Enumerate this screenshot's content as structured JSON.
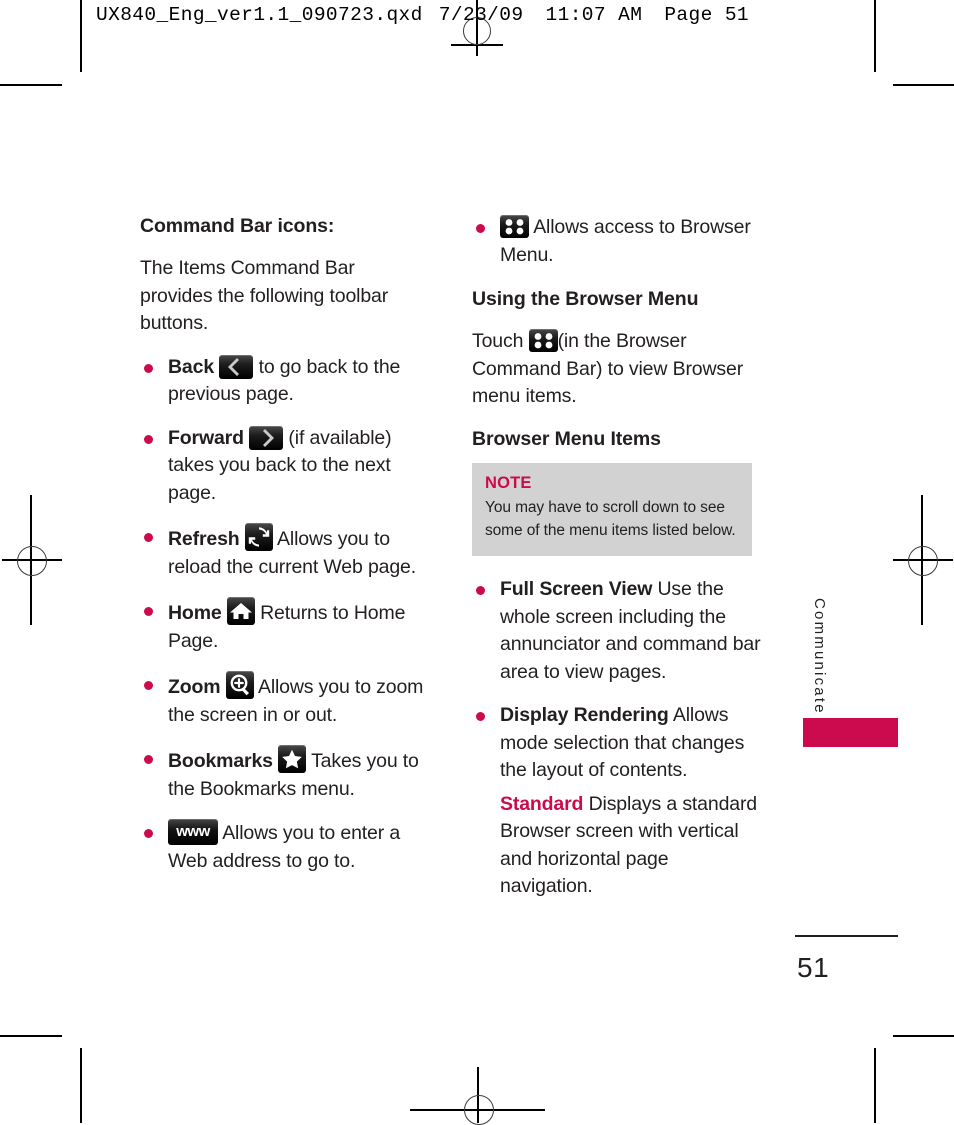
{
  "slug": {
    "filename": "UX840_Eng_ver1.1_090723.qxd",
    "date": "7/23/09",
    "time": "11:07 AM",
    "page_label": "Page 51"
  },
  "left_column": {
    "heading": "Command Bar icons:",
    "intro": "The Items Command Bar provides the following toolbar buttons.",
    "items": [
      {
        "term": "Back",
        "icon": "back-arrow-icon",
        "text": " to go back to the previous page."
      },
      {
        "term": "Forward",
        "icon": "forward-arrow-icon",
        "text": " (if available) takes you back to the next page."
      },
      {
        "term": "Refresh",
        "icon": "refresh-icon",
        "text": " Allows you to reload the current Web page."
      },
      {
        "term": "Home",
        "icon": "home-icon",
        "text": " Returns to Home Page."
      },
      {
        "term": "Zoom",
        "icon": "zoom-in-icon",
        "text": " Allows you to zoom the screen in or out."
      },
      {
        "term": "Bookmarks",
        "icon": "star-bookmark-icon",
        "text": " Takes you to the Bookmarks menu."
      },
      {
        "term": "",
        "icon": "www-icon",
        "text": " Allows you to enter a Web address to go to."
      }
    ]
  },
  "right_column": {
    "menu_bullet": {
      "icon": "four-dots-menu-icon",
      "text": " Allows access to Browser Menu."
    },
    "heading_using": "Using the Browser Menu",
    "touch_prefix": "Touch ",
    "touch_icon": "four-dots-menu-icon",
    "touch_suffix": "(in the Browser Command Bar) to view Browser menu items.",
    "heading_items": "Browser Menu Items",
    "note": {
      "title": "NOTE",
      "body": "You may have to scroll down to see some of the menu items listed below."
    },
    "items": [
      {
        "term": "Full Screen View",
        "text": " Use the whole screen including the annunciator and command bar area to view pages."
      },
      {
        "term": "Display Rendering",
        "text": " Allows mode selection that changes the layout of contents."
      }
    ],
    "sub_item": {
      "term": "Standard",
      "text": "  Displays a standard Browser screen with vertical and horizontal page navigation."
    }
  },
  "side_tab": {
    "label": "Communicate",
    "color": "#cc0a4e"
  },
  "footer": {
    "page_number": "51"
  },
  "colors": {
    "accent": "#cc0a4e",
    "note_bg": "#d2d2d2",
    "text": "#231f20"
  }
}
